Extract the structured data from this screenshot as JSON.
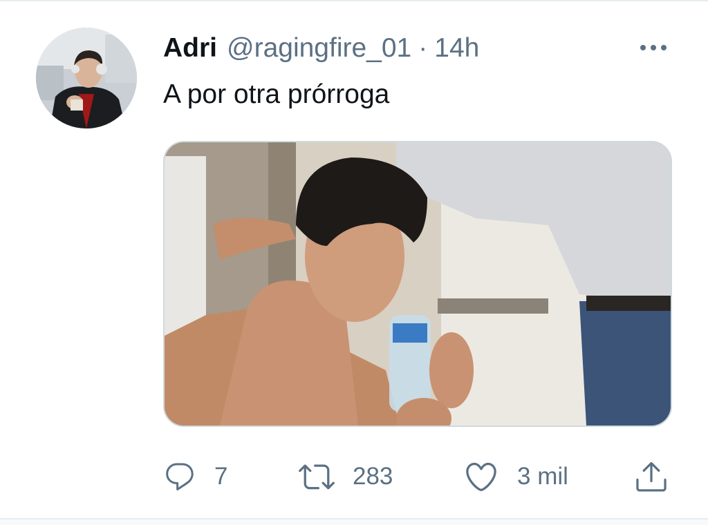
{
  "tweet": {
    "display_name": "Adri",
    "handle": "@ragingfire_01",
    "separator": "·",
    "time": "14h",
    "text": "A por otra prórroga"
  },
  "avatar": {
    "icon": "user-avatar-photo"
  },
  "media": {
    "icon": "photo-shirtless-man-drinking-water"
  },
  "actions": {
    "reply": {
      "icon": "reply-icon",
      "count": "7"
    },
    "retweet": {
      "icon": "retweet-icon",
      "count": "283"
    },
    "like": {
      "icon": "like-icon",
      "count": "3 mil"
    },
    "share": {
      "icon": "share-icon"
    }
  },
  "colors": {
    "text": "#0f1419",
    "secondary": "#5b7083",
    "border": "#cfd9de"
  }
}
